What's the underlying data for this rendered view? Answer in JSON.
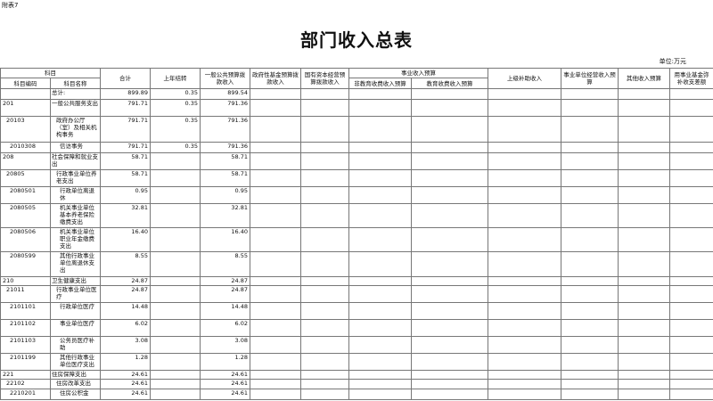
{
  "corner_label": "附表7",
  "title": "部门收入总表",
  "unit": "单位:万元",
  "headers": {
    "subject": "科目",
    "subject_code": "科目编码",
    "subject_name": "科目名称",
    "total": "合计",
    "carryover": "上年结转",
    "general_budget": "一般公共预算拨款收入",
    "gov_fund": "政府性基金预算拨款收入",
    "state_capital": "国有资本经营预算拨款收入",
    "business_budget": "事业收入预算",
    "non_edu_fee": "非教育收费收入预算",
    "edu_fee": "教育收费收入预算",
    "superior_subsidy": "上级补助收入",
    "affiliated_unit": "事业单位经营收入预算",
    "other_income": "其他收入预算",
    "business_fund": "用事业基金弥补收支差额"
  },
  "rows": [
    {
      "code": "",
      "name": "总计:",
      "total": "899.89",
      "carry": "0.35",
      "general": "899.54"
    },
    {
      "code": "201",
      "name": "一般公共服务支出",
      "total": "791.71",
      "carry": "0.35",
      "general": "791.36"
    },
    {
      "code": "20103",
      "name": "政府办公厅（室）及相关机构事务",
      "total": "791.71",
      "carry": "0.35",
      "general": "791.36"
    },
    {
      "code": "2010308",
      "name": "信访事务",
      "total": "791.71",
      "carry": "0.35",
      "general": "791.36"
    },
    {
      "code": "208",
      "name": "社会保障和就业支出",
      "total": "58.71",
      "carry": "",
      "general": "58.71"
    },
    {
      "code": "20805",
      "name": "行政事业单位养老支出",
      "total": "58.71",
      "carry": "",
      "general": "58.71"
    },
    {
      "code": "2080501",
      "name": "行政单位离退休",
      "total": "0.95",
      "carry": "",
      "general": "0.95"
    },
    {
      "code": "2080505",
      "name": "机关事业单位基本养老保险缴费支出",
      "total": "32.81",
      "carry": "",
      "general": "32.81"
    },
    {
      "code": "2080506",
      "name": "机关事业单位职业年金缴费支出",
      "total": "16.40",
      "carry": "",
      "general": "16.40"
    },
    {
      "code": "2080599",
      "name": "其他行政事业单位离退休支出",
      "total": "8.55",
      "carry": "",
      "general": "8.55"
    },
    {
      "code": "210",
      "name": "卫生健康支出",
      "total": "24.87",
      "carry": "",
      "general": "24.87"
    },
    {
      "code": "21011",
      "name": "行政事业单位医疗",
      "total": "24.87",
      "carry": "",
      "general": "24.87"
    },
    {
      "code": "2101101",
      "name": "行政单位医疗",
      "total": "14.48",
      "carry": "",
      "general": "14.48"
    },
    {
      "code": "2101102",
      "name": "事业单位医疗",
      "total": "6.02",
      "carry": "",
      "general": "6.02"
    },
    {
      "code": "2101103",
      "name": "公务员医疗补助",
      "total": "3.08",
      "carry": "",
      "general": "3.08"
    },
    {
      "code": "2101199",
      "name": "其他行政事业单位医疗支出",
      "total": "1.28",
      "carry": "",
      "general": "1.28"
    },
    {
      "code": "221",
      "name": "住房保障支出",
      "total": "24.61",
      "carry": "",
      "general": "24.61"
    },
    {
      "code": "22102",
      "name": "住房改革支出",
      "total": "24.61",
      "carry": "",
      "general": "24.61"
    },
    {
      "code": "2210201",
      "name": "住房公积金",
      "total": "24.61",
      "carry": "",
      "general": "24.61"
    }
  ]
}
